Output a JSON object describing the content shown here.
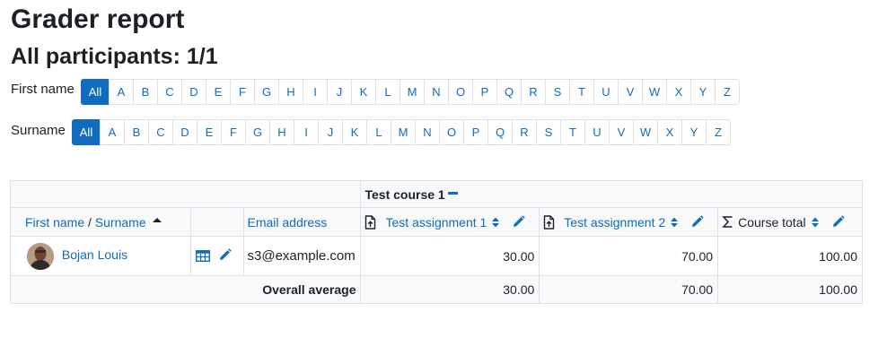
{
  "page": {
    "title": "Grader report",
    "subtitle": "All participants: 1/1"
  },
  "filters": {
    "firstname_label": "First name",
    "surname_label": "Surname",
    "all_label": "All",
    "letters": [
      "A",
      "B",
      "C",
      "D",
      "E",
      "F",
      "G",
      "H",
      "I",
      "J",
      "K",
      "L",
      "M",
      "N",
      "O",
      "P",
      "Q",
      "R",
      "S",
      "T",
      "U",
      "V",
      "W",
      "X",
      "Y",
      "Z"
    ]
  },
  "table": {
    "category": "Test course 1",
    "headers": {
      "firstname": "First name",
      "separator": "/",
      "surname": "Surname",
      "email": "Email address",
      "item1": "Test assignment 1",
      "item2": "Test assignment 2",
      "total": "Course total"
    },
    "user": {
      "name": "Bojan Louis",
      "email": "s3@example.com",
      "grade1": "30.00",
      "grade2": "70.00",
      "total": "100.00"
    },
    "average": {
      "label": "Overall average",
      "grade1": "30.00",
      "grade2": "70.00",
      "total": "100.00"
    }
  },
  "colors": {
    "link": "#0f6cbf",
    "header_bg": "#f8f9fa",
    "border": "#dee2e6"
  }
}
